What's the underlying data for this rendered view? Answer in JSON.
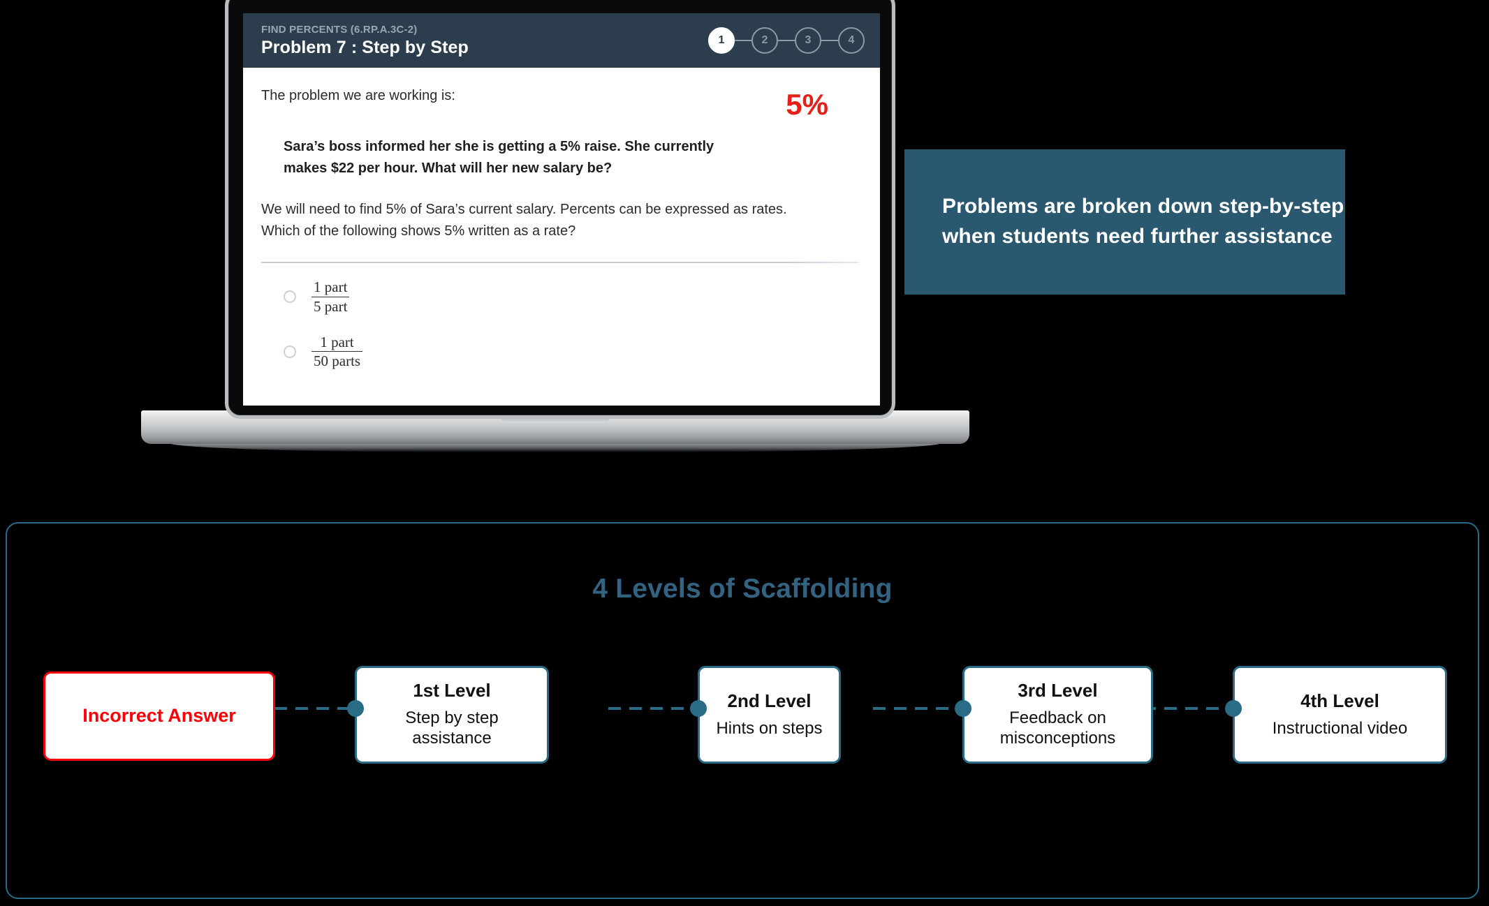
{
  "app": {
    "standard_label": "FIND PERCENTS (6.RP.A.3C-2)",
    "problem_title": "Problem 7 : Step by Step",
    "steps": [
      {
        "number": "1",
        "active": true
      },
      {
        "number": "2",
        "active": false
      },
      {
        "number": "3",
        "active": false
      },
      {
        "number": "4",
        "active": false
      }
    ],
    "intro_text": "The problem we are working is:",
    "percent_badge": "5%",
    "problem_statement": "Sara’s boss informed her she is getting a 5% raise. She currently makes $22 per hour. What will her new salary be?",
    "question_text": "We will need to find 5% of Sara’s current salary. Percents can be expressed as rates. Which of the following shows 5% written as a rate?",
    "choices": [
      {
        "numerator": "1 part",
        "denominator": "5 part",
        "selected": false
      },
      {
        "numerator": "1 part",
        "denominator": "50 parts",
        "selected": false
      }
    ]
  },
  "callout": {
    "text": "Problems are broken down step-by-step when students need further assistance"
  },
  "scaffolding": {
    "title": "4 Levels of Scaffolding",
    "nodes": [
      {
        "title": "Incorrect Answer",
        "desc": "",
        "variant": "incorrect"
      },
      {
        "title": "1st Level",
        "desc": "Step by step assistance",
        "variant": "level"
      },
      {
        "title": "2nd Level",
        "desc": "Hints on steps",
        "variant": "level"
      },
      {
        "title": "3rd Level",
        "desc": "Feedback on misconceptions",
        "variant": "level"
      },
      {
        "title": "4th Level",
        "desc": "Instructional video",
        "variant": "level"
      }
    ]
  },
  "colors": {
    "header_bg": "#2c3e4d",
    "callout_bg": "#2a586e",
    "accent_teal": "#2a6b86",
    "title_teal": "#336380",
    "alert_red": "#fb0007",
    "percent_red": "#e32119"
  }
}
